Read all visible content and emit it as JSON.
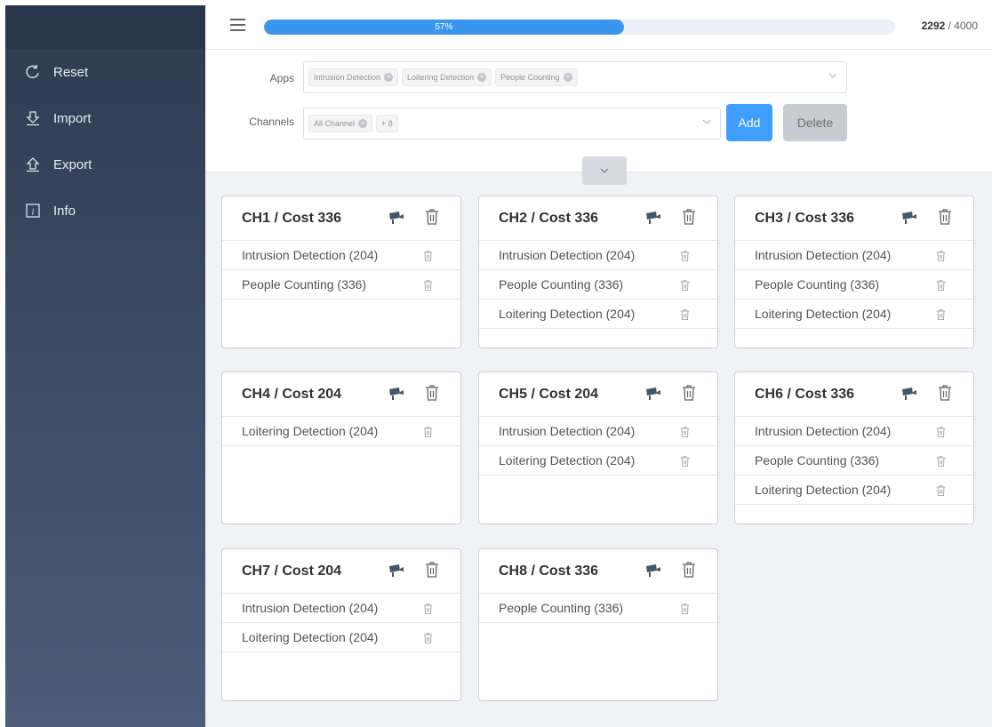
{
  "sidebar": {
    "items": [
      {
        "label": "Reset",
        "icon": "reset-icon"
      },
      {
        "label": "Import",
        "icon": "import-icon"
      },
      {
        "label": "Export",
        "icon": "export-icon"
      },
      {
        "label": "Info",
        "icon": "info-icon"
      }
    ]
  },
  "topbar": {
    "progress_label": "57%",
    "progress_value": 57,
    "used": "2292",
    "total_text": " / 4000"
  },
  "filters": {
    "apps_label": "Apps",
    "apps_tags": [
      "Intrusion Detection",
      "Loitering Detection",
      "People Counting"
    ],
    "channels_label": "Channels",
    "channel_tags": [
      "All Channel"
    ],
    "channel_more": "+ 8",
    "add_label": "Add",
    "delete_label": "Delete"
  },
  "channels": [
    {
      "title": "CH1 / Cost 336",
      "apps": [
        "Intrusion Detection (204)",
        "People Counting (336)"
      ]
    },
    {
      "title": "CH2 / Cost 336",
      "apps": [
        "Intrusion Detection (204)",
        "People Counting (336)",
        "Loitering Detection (204)"
      ]
    },
    {
      "title": "CH3 / Cost 336",
      "apps": [
        "Intrusion Detection (204)",
        "People Counting (336)",
        "Loitering Detection (204)"
      ]
    },
    {
      "title": "CH4 / Cost 204",
      "apps": [
        "Loitering Detection (204)"
      ]
    },
    {
      "title": "CH5 / Cost 204",
      "apps": [
        "Intrusion Detection (204)",
        "Loitering Detection (204)"
      ]
    },
    {
      "title": "CH6 / Cost 336",
      "apps": [
        "Intrusion Detection (204)",
        "People Counting (336)",
        "Loitering Detection (204)"
      ]
    },
    {
      "title": "CH7 / Cost 204",
      "apps": [
        "Intrusion Detection (204)",
        "Loitering Detection (204)"
      ]
    },
    {
      "title": "CH8 / Cost 336",
      "apps": [
        "People Counting (336)"
      ]
    }
  ],
  "colors": {
    "primary": "#409eff",
    "progress": "#3a95ee",
    "sidebar_top": "#2e3c51",
    "sidebar_bottom": "#4b5c78"
  }
}
